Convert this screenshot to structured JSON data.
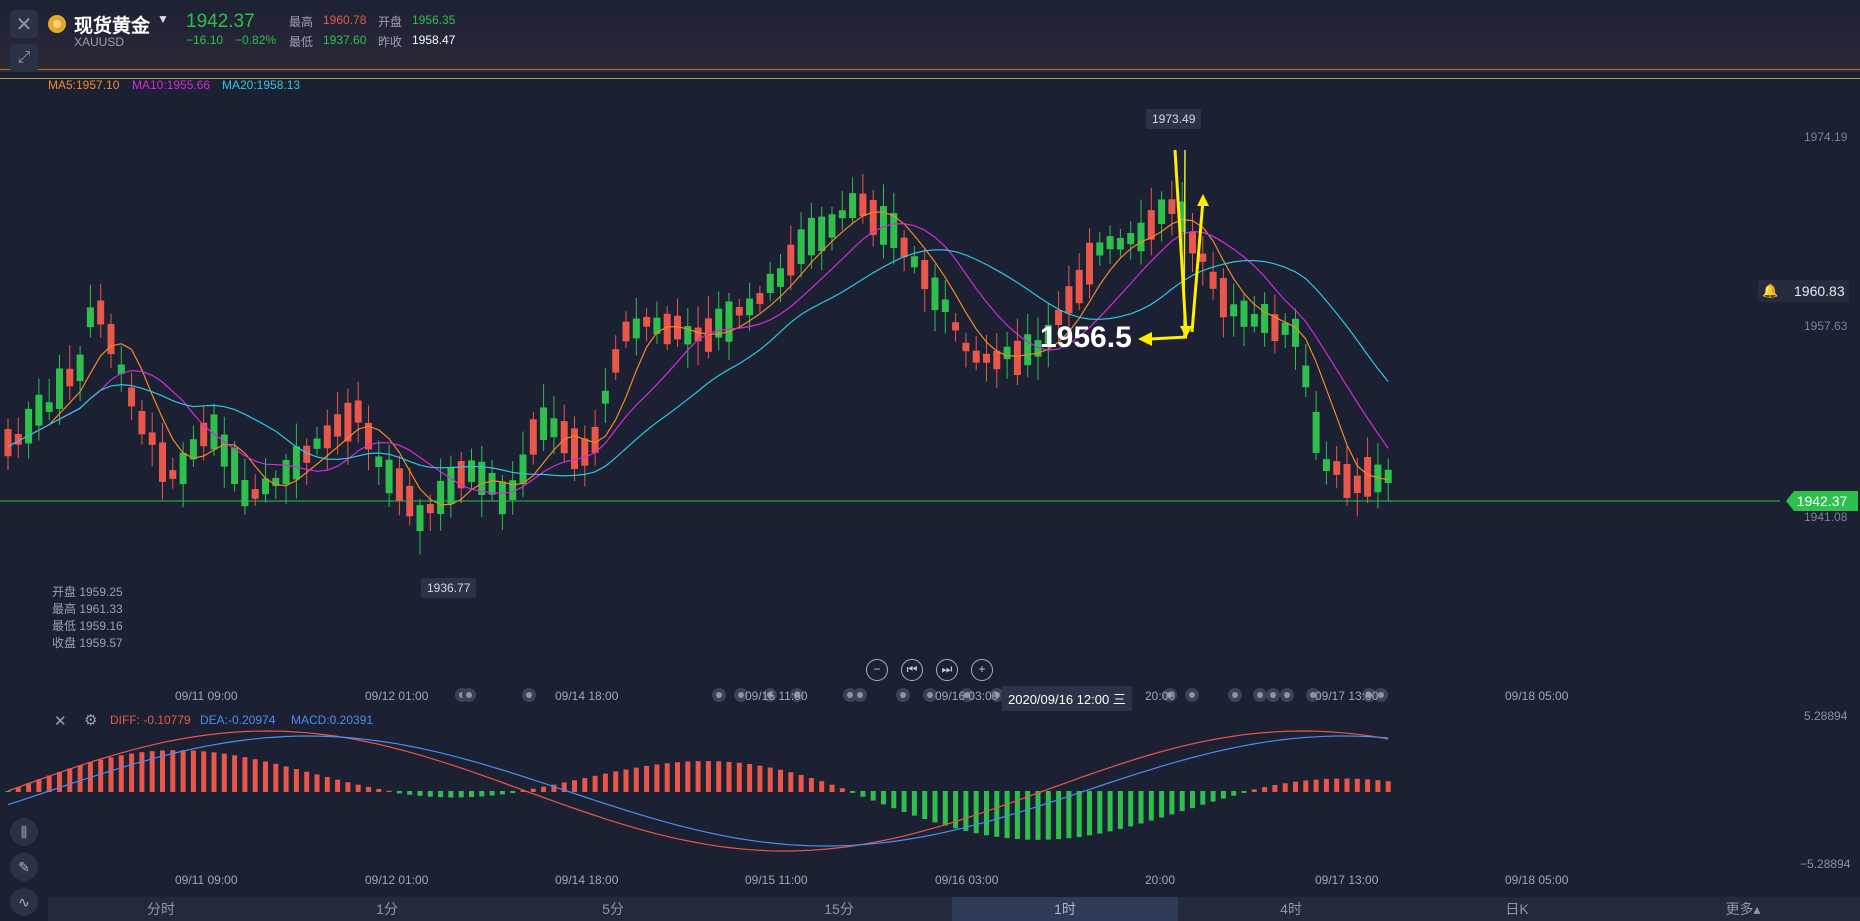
{
  "header": {
    "name": "现货黄金",
    "code": "XAUUSD",
    "price": "1942.37",
    "change": "−16.10",
    "change_pct": "−0.82%",
    "high_label": "最高",
    "high_value": "1960.78",
    "open_label": "开盘",
    "open_value": "1956.35",
    "low_label": "最低",
    "low_value": "1937.60",
    "prev_label": "昨收",
    "prev_value": "1958.47"
  },
  "ma": {
    "ma5": "MA5:1957.10",
    "ma10": "MA10:1955.66",
    "ma20": "MA20:1958.13"
  },
  "price_axis": {
    "top": "1974.19",
    "alert": "1960.83",
    "mid": "1957.63",
    "current": "1942.37",
    "bottom": "1941.08"
  },
  "markers": {
    "high": "1973.49",
    "low": "1936.77"
  },
  "annotation": "1956.5",
  "ohlc": {
    "open": "开盘 1959.25",
    "high": "最高 1961.33",
    "low": "最低 1959.16",
    "close": "收盘 1959.57"
  },
  "time_axis": [
    "09/11 09:00",
    "09/12 01:00",
    "09/14 18:00",
    "09/15 11:00",
    "09/16 03:00",
    "20:00",
    "09/17 13:00",
    "09/18 05:00"
  ],
  "cursor_time": "2020/09/16 12:00 三",
  "macd": {
    "diff": "DIFF: -0.10779",
    "dea": "DEA:-0.20974",
    "macd": "MACD:0.20391",
    "top": "5.28894",
    "bottom": "−5.28894"
  },
  "tabs": [
    "分时",
    "1分",
    "5分",
    "15分",
    "1时",
    "4时",
    "日K",
    "更多▴"
  ],
  "active_tab": "1时",
  "colors": {
    "bg": "#1b2033",
    "up": "#e9564a",
    "down": "#2fbf4c",
    "ma5": "#f08a24",
    "ma10": "#d42ad9",
    "ma20": "#2ec6e0",
    "annotation": "#ffee00"
  }
}
